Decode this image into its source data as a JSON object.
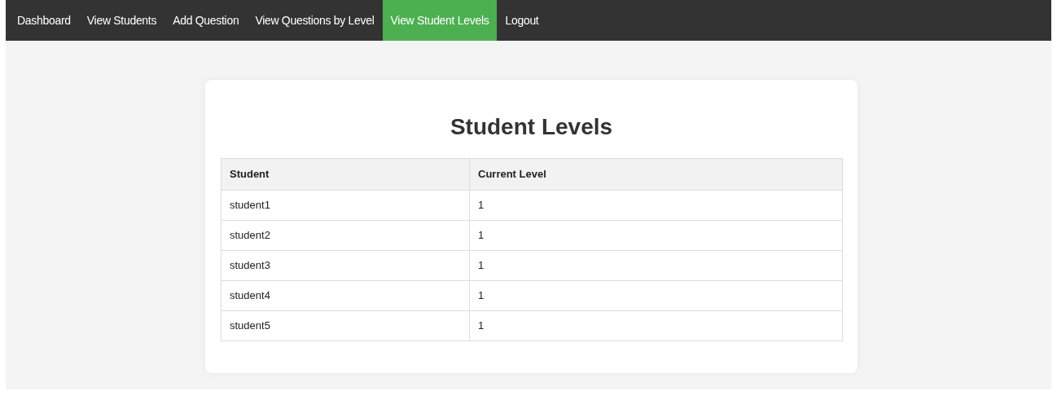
{
  "nav": [
    {
      "label": "Dashboard",
      "selected": false
    },
    {
      "label": "View Students",
      "selected": false
    },
    {
      "label": "Add Question",
      "selected": false
    },
    {
      "label": "View Questions by Level",
      "selected": false
    },
    {
      "label": "View Student Levels",
      "selected": true
    },
    {
      "label": "Logout",
      "selected": false
    }
  ],
  "title": "Student Levels",
  "table": {
    "columns": [
      "Student",
      "Current Level"
    ],
    "rows": [
      [
        "student1",
        "1"
      ],
      [
        "student2",
        "1"
      ],
      [
        "student3",
        "1"
      ],
      [
        "student4",
        "1"
      ],
      [
        "student5",
        "1"
      ]
    ]
  }
}
